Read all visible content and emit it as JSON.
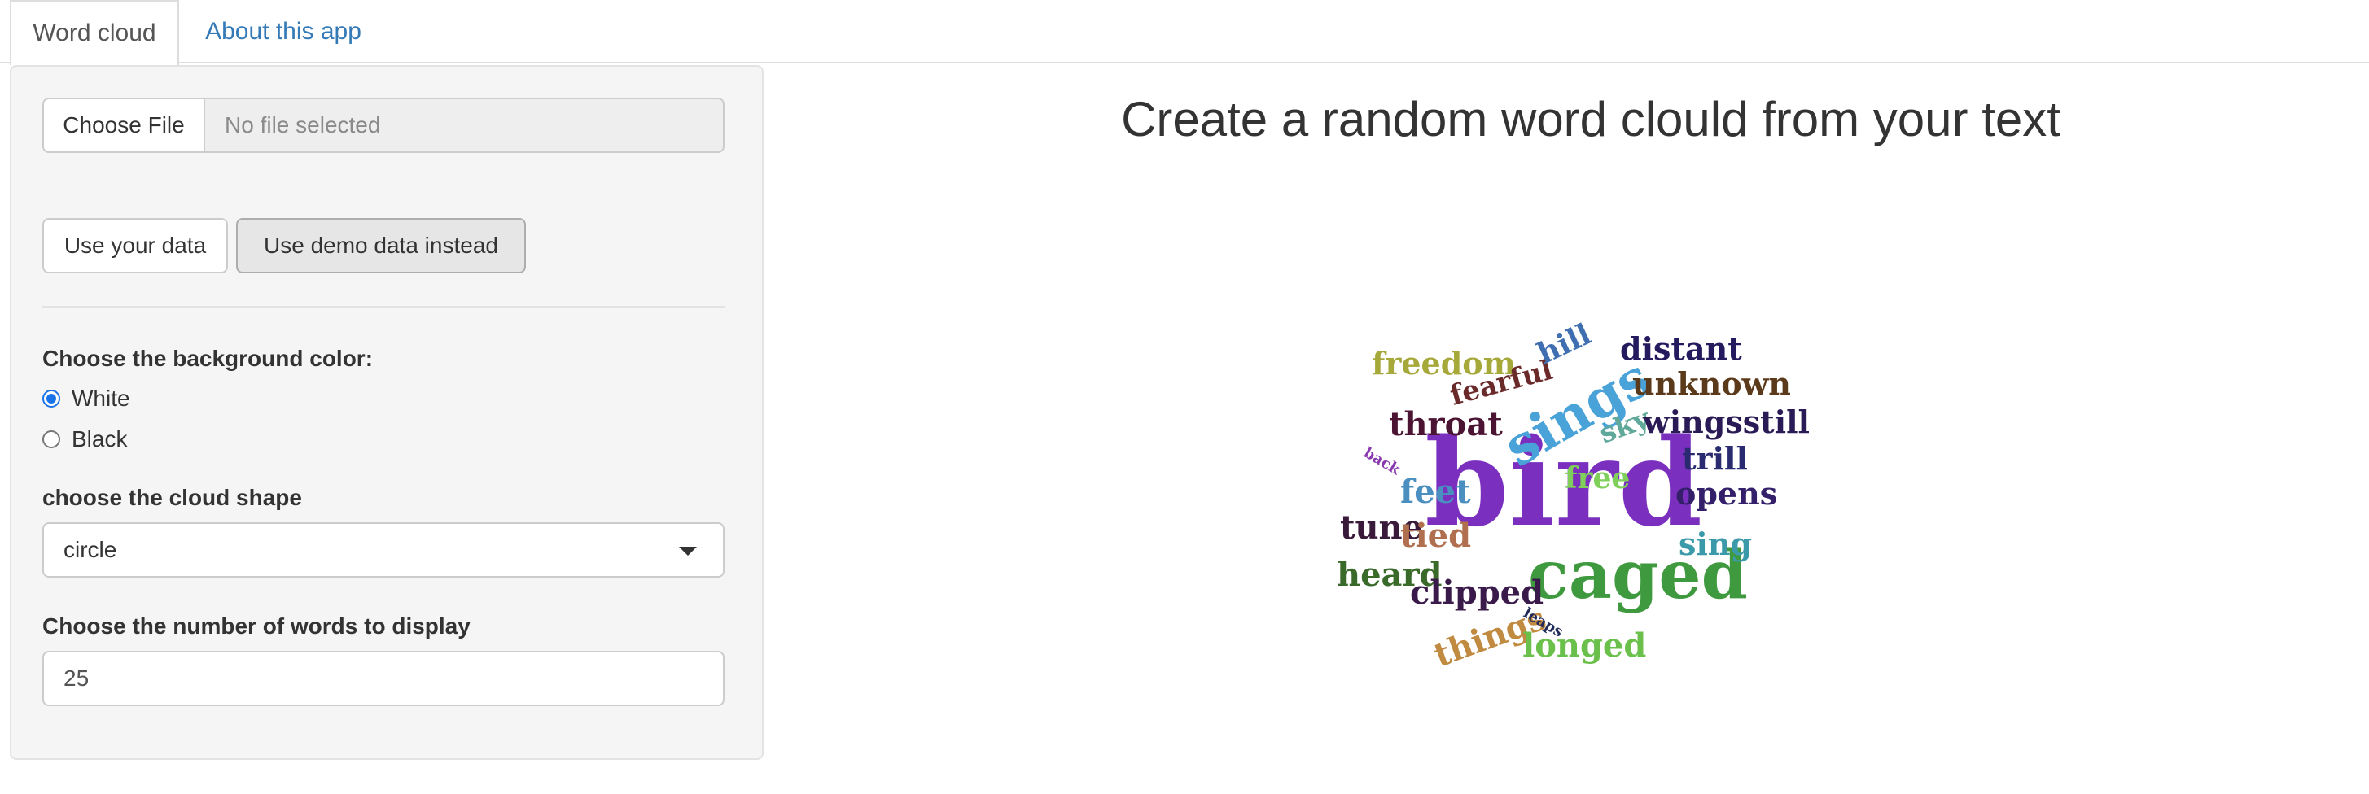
{
  "tabs": [
    {
      "label": "Word cloud",
      "active": true
    },
    {
      "label": "About this app",
      "active": false
    }
  ],
  "sidebar": {
    "file": {
      "button_label": "Choose File",
      "status": "No file selected"
    },
    "use_your_data_label": "Use your data",
    "use_demo_label": "Use demo data instead",
    "bg_color": {
      "label": "Choose the background color:",
      "options": [
        {
          "label": "White",
          "checked": true
        },
        {
          "label": "Black",
          "checked": false
        }
      ]
    },
    "shape": {
      "label": "choose the cloud shape",
      "value": "circle"
    },
    "num_words": {
      "label": "Choose the number of words to display",
      "value": "25"
    }
  },
  "main": {
    "title": "Create a random word clould from your text"
  },
  "wordcloud": {
    "words": [
      {
        "text": "bird",
        "color": "#7b2fbf"
      },
      {
        "text": "caged",
        "color": "#3f9a3f"
      },
      {
        "text": "sings",
        "color": "#4aa3d8"
      },
      {
        "text": "freedom",
        "color": "#a6a83a"
      },
      {
        "text": "fearful",
        "color": "#6b2a2a"
      },
      {
        "text": "hill",
        "color": "#3f6fb0"
      },
      {
        "text": "distant",
        "color": "#241a5e"
      },
      {
        "text": "unknown",
        "color": "#5a3a1a"
      },
      {
        "text": "throat",
        "color": "#4a1432"
      },
      {
        "text": "sky",
        "color": "#5fa89a"
      },
      {
        "text": "wingsstill",
        "color": "#2a1a55"
      },
      {
        "text": "trill",
        "color": "#2a2a70"
      },
      {
        "text": "back",
        "color": "#8a3ab0"
      },
      {
        "text": "feet",
        "color": "#4a8fc0"
      },
      {
        "text": "free",
        "color": "#7fd05a"
      },
      {
        "text": "opens",
        "color": "#34206a"
      },
      {
        "text": "tune",
        "color": "#3a1a3a"
      },
      {
        "text": "tied",
        "color": "#b07050"
      },
      {
        "text": "sing",
        "color": "#3a9aaa"
      },
      {
        "text": "heard",
        "color": "#3a6a2a"
      },
      {
        "text": "clipped",
        "color": "#3a1a4a"
      },
      {
        "text": "things",
        "color": "#c08a40"
      },
      {
        "text": "leaps",
        "color": "#222a5a"
      },
      {
        "text": "longed",
        "color": "#6ac04a"
      }
    ]
  }
}
